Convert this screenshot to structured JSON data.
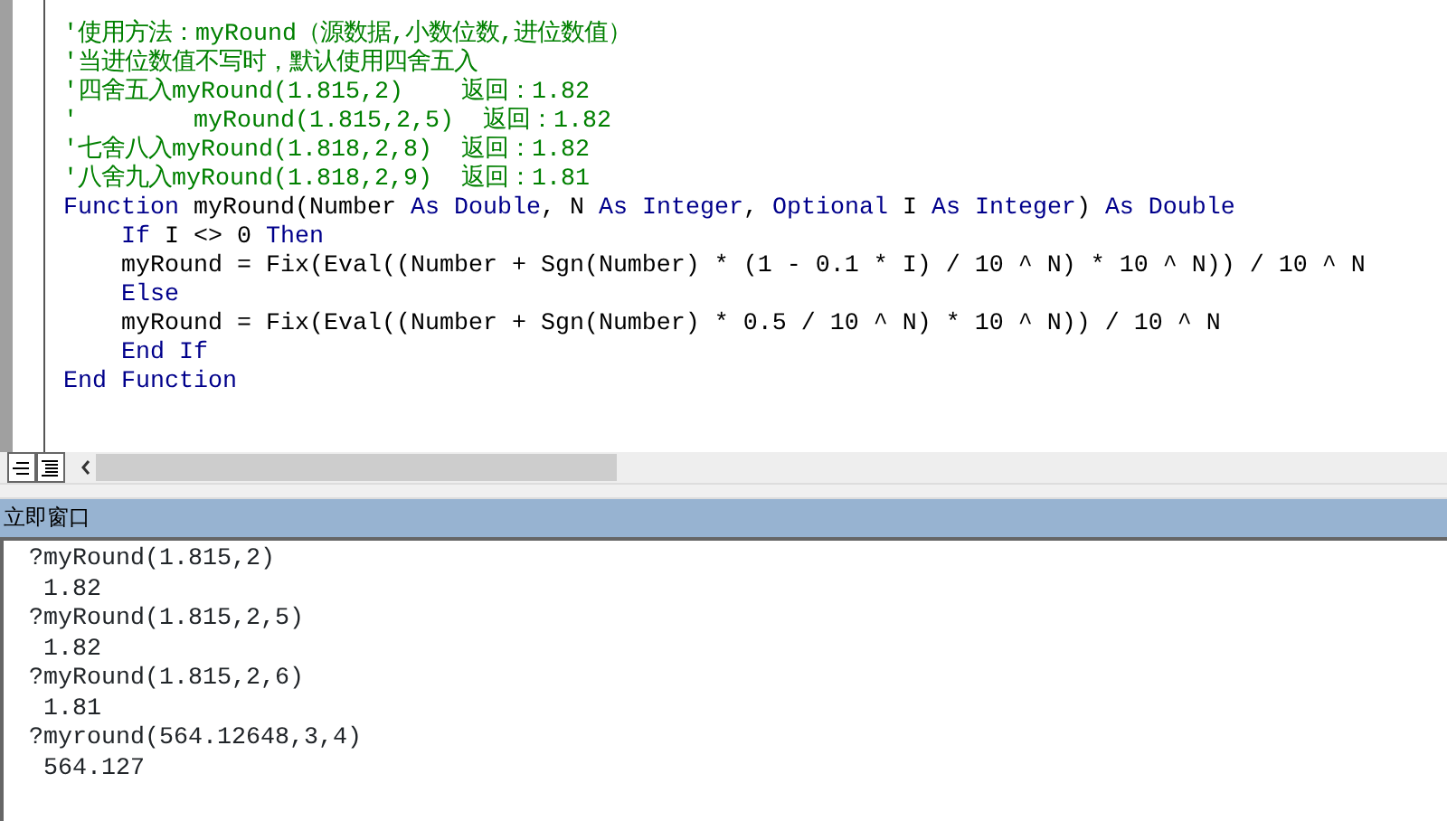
{
  "code_window": {
    "lines": [
      {
        "indented": false,
        "segments": [
          {
            "kind": "comment",
            "text": "'使用方法：myRound（源数据,小数位数,进位数值）"
          }
        ]
      },
      {
        "indented": false,
        "segments": [
          {
            "kind": "comment",
            "text": "'当进位数值不写时，默认使用四舍五入"
          }
        ]
      },
      {
        "indented": false,
        "segments": [
          {
            "kind": "comment",
            "text": "'四舍五入myRound(1.815,2)    返回：1.82"
          }
        ]
      },
      {
        "indented": false,
        "segments": [
          {
            "kind": "comment",
            "text": "'        myRound(1.815,2,5)  返回：1.82"
          }
        ]
      },
      {
        "indented": false,
        "segments": [
          {
            "kind": "comment",
            "text": "'七舍八入myRound(1.818,2,8)  返回：1.82"
          }
        ]
      },
      {
        "indented": false,
        "segments": [
          {
            "kind": "comment",
            "text": "'八舍九入myRound(1.818,2,9)  返回：1.81"
          }
        ]
      },
      {
        "indented": false,
        "segments": [
          {
            "kind": "keyword",
            "text": "Function"
          },
          {
            "kind": "plain",
            "text": " myRound(Number "
          },
          {
            "kind": "keyword",
            "text": "As Double"
          },
          {
            "kind": "plain",
            "text": ", N "
          },
          {
            "kind": "keyword",
            "text": "As Integer"
          },
          {
            "kind": "plain",
            "text": ", "
          },
          {
            "kind": "keyword",
            "text": "Optional"
          },
          {
            "kind": "plain",
            "text": " I "
          },
          {
            "kind": "keyword",
            "text": "As Integer"
          },
          {
            "kind": "plain",
            "text": ") "
          },
          {
            "kind": "keyword",
            "text": "As Double"
          }
        ]
      },
      {
        "indented": true,
        "segments": [
          {
            "kind": "keyword",
            "text": "If"
          },
          {
            "kind": "plain",
            "text": " I <> 0 "
          },
          {
            "kind": "keyword",
            "text": "Then"
          }
        ]
      },
      {
        "indented": true,
        "segments": [
          {
            "kind": "plain",
            "text": "myRound = Fix(Eval((Number + Sgn(Number) * (1 - 0.1 * I) / 10 ^ N) * 10 ^ N)) / 10 ^ N"
          }
        ]
      },
      {
        "indented": true,
        "segments": [
          {
            "kind": "keyword",
            "text": "Else"
          }
        ]
      },
      {
        "indented": true,
        "segments": [
          {
            "kind": "plain",
            "text": "myRound = Fix(Eval((Number + Sgn(Number) * 0.5 / 10 ^ N) * 10 ^ N)) / 10 ^ N"
          }
        ]
      },
      {
        "indented": true,
        "segments": [
          {
            "kind": "keyword",
            "text": "End If"
          }
        ]
      },
      {
        "indented": false,
        "segments": [
          {
            "kind": "keyword",
            "text": "End Function"
          }
        ]
      }
    ]
  },
  "immediate_window": {
    "title": "立即窗口",
    "lines": [
      "?myRound(1.815,2)",
      " 1.82",
      "?myRound(1.815,2,5)",
      " 1.82",
      "?myRound(1.815,2,6)",
      " 1.81",
      "?myround(564.12648,3,4)",
      " 564.127"
    ]
  }
}
